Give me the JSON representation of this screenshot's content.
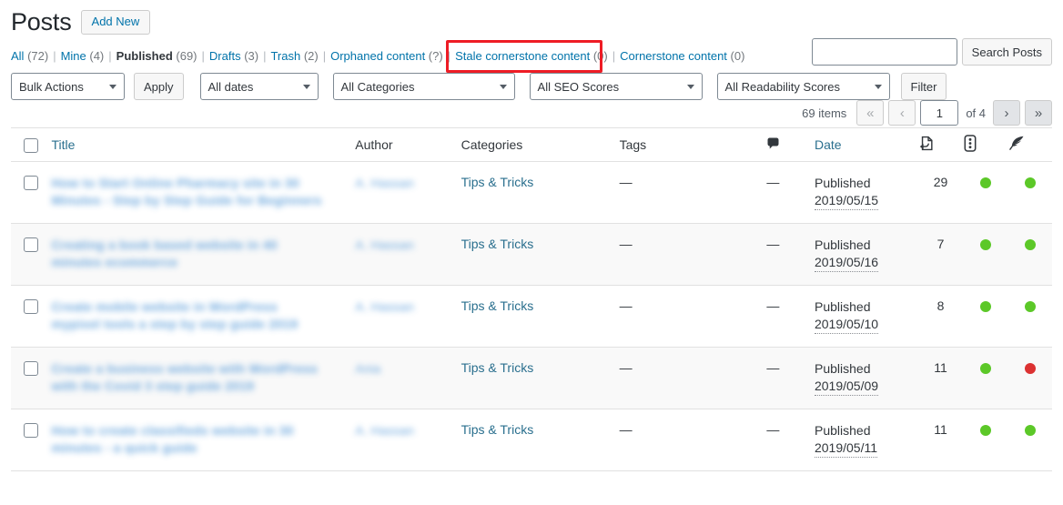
{
  "header": {
    "title": "Posts",
    "add_new_label": "Add New"
  },
  "filter_links": [
    {
      "label": "All",
      "count": "(72)",
      "current": false
    },
    {
      "label": "Mine",
      "count": "(4)",
      "current": false
    },
    {
      "label": "Published",
      "count": "(69)",
      "current": true
    },
    {
      "label": "Drafts",
      "count": "(3)",
      "current": false
    },
    {
      "label": "Trash",
      "count": "(2)",
      "current": false
    },
    {
      "label": "Orphaned content",
      "count": "(?)",
      "current": false
    },
    {
      "label": "Stale cornerstone content",
      "count": "(0)",
      "current": false,
      "highlighted": true
    },
    {
      "label": "Cornerstone content",
      "count": "(0)",
      "current": false
    }
  ],
  "search": {
    "value": "",
    "placeholder": "",
    "button_label": "Search Posts"
  },
  "toolbar": {
    "bulk_actions": "Bulk Actions",
    "apply_label": "Apply",
    "all_dates": "All dates",
    "all_categories": "All Categories",
    "all_seo_scores": "All SEO Scores",
    "all_readability_scores": "All Readability Scores",
    "filter_label": "Filter"
  },
  "pagination": {
    "items_label": "69 items",
    "first_label": "«",
    "prev_label": "‹",
    "current_page": "1",
    "of_label": "of 4",
    "next_label": "›",
    "last_label": "»"
  },
  "table": {
    "columns": {
      "title": "Title",
      "author": "Author",
      "categories": "Categories",
      "tags": "Tags",
      "comments_icon": "comment-bubble-icon",
      "date": "Date",
      "links_icon": "incoming-links-icon",
      "seo_icon": "seo-score-traffic-light-icon",
      "readability_icon": "readability-quill-icon"
    },
    "rows": [
      {
        "title": "How to Start Online Pharmacy site in 30 Minutes - Step by Step Guide for Beginners",
        "author": "A. Hassan",
        "category": "Tips & Tricks",
        "tags": "—",
        "comments": "—",
        "status": "Published",
        "date": "2019/05/15",
        "links": "29",
        "seo_score": "green",
        "readability_score": "green"
      },
      {
        "title": "Creating a book based website in 40 minutes ecommerce",
        "author": "A. Hassan",
        "category": "Tips & Tricks",
        "tags": "—",
        "comments": "—",
        "status": "Published",
        "date": "2019/05/16",
        "links": "7",
        "seo_score": "green",
        "readability_score": "green"
      },
      {
        "title": "Create mobile website in WordPress mypixel tools a step by step guide 2019",
        "author": "A. Hassan",
        "category": "Tips & Tricks",
        "tags": "—",
        "comments": "—",
        "status": "Published",
        "date": "2019/05/10",
        "links": "8",
        "seo_score": "green",
        "readability_score": "green"
      },
      {
        "title": "Create a business website with WordPress with the Covid 3 step guide 2019",
        "author": "Ania",
        "category": "Tips & Tricks",
        "tags": "—",
        "comments": "—",
        "status": "Published",
        "date": "2019/05/09",
        "links": "11",
        "seo_score": "green",
        "readability_score": "red"
      },
      {
        "title": "How to create classifieds website in 30 minutes - a quick guide",
        "author": "A. Hassan",
        "category": "Tips & Tricks",
        "tags": "—",
        "comments": "—",
        "status": "Published",
        "date": "2019/05/11",
        "links": "11",
        "seo_score": "green",
        "readability_score": "green"
      }
    ]
  },
  "colors": {
    "link": "#0073aa",
    "score_green": "#5cc828",
    "score_red": "#dc3232",
    "highlight_box": "#ee1c25"
  }
}
